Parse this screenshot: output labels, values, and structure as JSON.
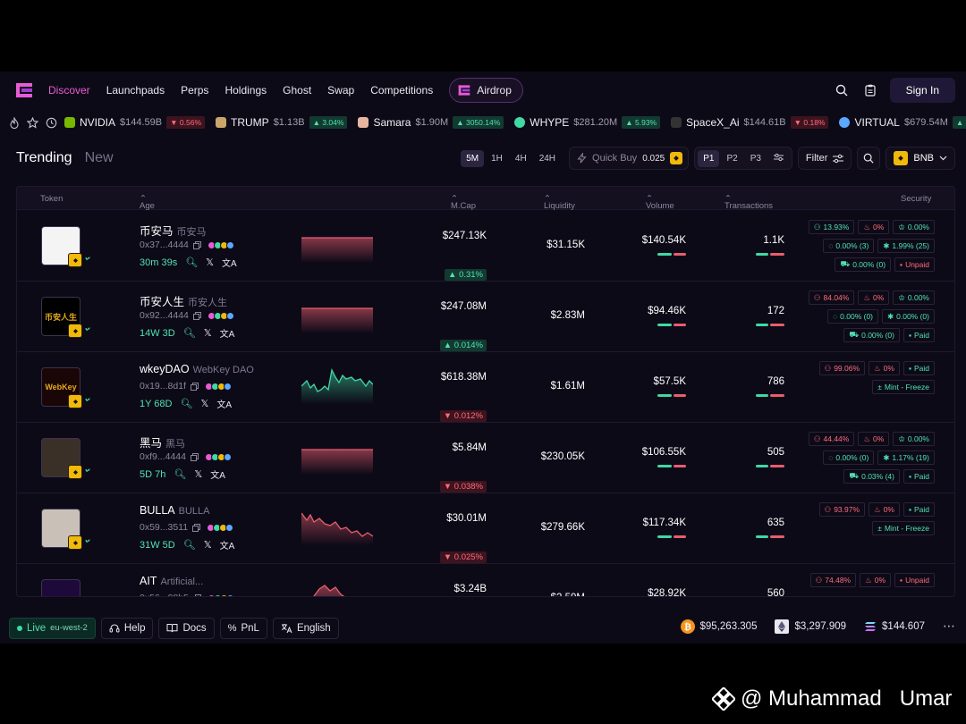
{
  "nav": {
    "items": [
      "Discover",
      "Launchpads",
      "Perps",
      "Holdings",
      "Ghost",
      "Swap",
      "Competitions"
    ],
    "airdrop_label": "Airdrop",
    "signin_label": "Sign In"
  },
  "ticker": [
    {
      "name": "NVIDIA",
      "value": "$144.59B",
      "change": "0.56%",
      "dir": "down",
      "color": "#76b900"
    },
    {
      "name": "TRUMP",
      "value": "$1.13B",
      "change": "3.04%",
      "dir": "up",
      "color": "#c9a56b"
    },
    {
      "name": "Samara",
      "value": "$1.90M",
      "change": "3050.14%",
      "dir": "up",
      "color": "#e8b6a0"
    },
    {
      "name": "WHYPE",
      "value": "$281.20M",
      "change": "5.93%",
      "dir": "up",
      "color": "#3fd9a4"
    },
    {
      "name": "SpaceX_Ai",
      "value": "$144.61B",
      "change": "0.18%",
      "dir": "down",
      "color": "#444444"
    },
    {
      "name": "VIRTUAL",
      "value": "$679.54M",
      "change": "3.",
      "dir": "up",
      "color": "#5aa8ff"
    }
  ],
  "trending": {
    "tabs": [
      "Trending",
      "New"
    ],
    "timeframes": [
      "5M",
      "1H",
      "4H",
      "24H"
    ],
    "quick_buy_label": "Quick Buy",
    "quick_buy_amount": "0.025",
    "presets": [
      "P1",
      "P2",
      "P3"
    ],
    "filter_label": "Filter",
    "chain_label": "BNB"
  },
  "table": {
    "headers": {
      "token": "Token",
      "age": "Age",
      "mcap": "M.Cap",
      "liquidity": "Liquidity",
      "volume": "Volume",
      "transactions": "Transactions",
      "security": "Security"
    },
    "rows": [
      {
        "name": "币安马",
        "sub": "币安马",
        "addr": "0x37...4444",
        "age": "30m 39s",
        "mcap": "$247.13K",
        "mchg": "0.31%",
        "mdir": "up",
        "liq": "$31.15K",
        "vol": "$140.54K",
        "txn": "1.1K",
        "spark": "flat",
        "avatar_color": "#f4f4f4",
        "sec": [
          [
            {
              "t": "13.93%",
              "c": "green",
              "i": "users"
            },
            {
              "t": "0%",
              "c": "red",
              "i": "fire"
            },
            {
              "t": "0.00%",
              "c": "green",
              "i": "chef"
            }
          ],
          [
            {
              "t": "0.00% (3)",
              "c": "green",
              "i": "ring"
            },
            {
              "t": "1.99% (25)",
              "c": "green",
              "i": "star"
            }
          ],
          [
            {
              "t": "0.00% (0)",
              "c": "green",
              "i": "car"
            },
            {
              "t": "Unpaid",
              "c": "red",
              "i": "lock"
            }
          ]
        ]
      },
      {
        "name": "币安人生",
        "sub": "币安人生",
        "addr": "0x92...4444",
        "age": "14W 3D",
        "mcap": "$247.08M",
        "mchg": "0.014%",
        "mdir": "up",
        "liq": "$2.83M",
        "vol": "$94.46K",
        "txn": "172",
        "spark": "flat",
        "avatar_color": "#000000",
        "avatar_text": "币安人生",
        "sec": [
          [
            {
              "t": "84.04%",
              "c": "red",
              "i": "users"
            },
            {
              "t": "0%",
              "c": "red",
              "i": "fire"
            },
            {
              "t": "0.00%",
              "c": "green",
              "i": "chef"
            }
          ],
          [
            {
              "t": "0.00% (0)",
              "c": "green",
              "i": "ring"
            },
            {
              "t": "0.00% (0)",
              "c": "green",
              "i": "star"
            }
          ],
          [
            {
              "t": "0.00% (0)",
              "c": "green",
              "i": "car"
            },
            {
              "t": "Paid",
              "c": "green",
              "i": "lock"
            }
          ]
        ]
      },
      {
        "name": "wkeyDAO",
        "sub": "WebKey DAO",
        "addr": "0x19...8d1f",
        "age": "1Y 68D",
        "mcap": "$618.38M",
        "mchg": "0.012%",
        "mdir": "down",
        "liq": "$1.61M",
        "vol": "$57.5K",
        "txn": "786",
        "spark": "green",
        "avatar_color": "#1a0606",
        "avatar_text": "WebKey",
        "sec": [
          [
            {
              "t": "99.06%",
              "c": "red",
              "i": "users"
            },
            {
              "t": "0%",
              "c": "red",
              "i": "fire"
            },
            {
              "t": "Paid",
              "c": "green",
              "i": "lock"
            }
          ],
          [
            {
              "t": "Mint - Freeze",
              "c": "green",
              "i": "plus"
            }
          ]
        ]
      },
      {
        "name": "黑马",
        "sub": "黑马",
        "addr": "0xf9...4444",
        "age": "5D 7h",
        "mcap": "$5.84M",
        "mchg": "0.038%",
        "mdir": "down",
        "liq": "$230.05K",
        "vol": "$106.55K",
        "txn": "505",
        "spark": "flat",
        "avatar_color": "#3a3028",
        "sec": [
          [
            {
              "t": "44.44%",
              "c": "red",
              "i": "users"
            },
            {
              "t": "0%",
              "c": "red",
              "i": "fire"
            },
            {
              "t": "0.00%",
              "c": "green",
              "i": "chef"
            }
          ],
          [
            {
              "t": "0.00% (0)",
              "c": "green",
              "i": "ring"
            },
            {
              "t": "1.17% (19)",
              "c": "green",
              "i": "star"
            }
          ],
          [
            {
              "t": "0.03% (4)",
              "c": "green",
              "i": "car"
            },
            {
              "t": "Paid",
              "c": "green",
              "i": "lock"
            }
          ]
        ]
      },
      {
        "name": "BULLA",
        "sub": "BULLA",
        "addr": "0x59...3511",
        "age": "31W 5D",
        "mcap": "$30.01M",
        "mchg": "0.025%",
        "mdir": "down",
        "liq": "$279.66K",
        "vol": "$117.34K",
        "txn": "635",
        "spark": "red",
        "avatar_color": "#c9c0b8",
        "sec": [
          [
            {
              "t": "93.97%",
              "c": "red",
              "i": "users"
            },
            {
              "t": "0%",
              "c": "red",
              "i": "fire"
            },
            {
              "t": "Paid",
              "c": "green",
              "i": "lock"
            }
          ],
          [
            {
              "t": "Mint - Freeze",
              "c": "green",
              "i": "plus"
            }
          ]
        ]
      },
      {
        "name": "AIT",
        "sub": "Artificial...",
        "addr": "0x56...08b5",
        "age": "",
        "mcap": "$3.24B",
        "mchg": "",
        "mdir": "down",
        "liq": "$2.59M",
        "vol": "$28.92K",
        "txn": "560",
        "spark": "red2",
        "avatar_color": "#1e0a3a",
        "sec": [
          [
            {
              "t": "74.48%",
              "c": "red",
              "i": "users"
            },
            {
              "t": "0%",
              "c": "red",
              "i": "fire"
            },
            {
              "t": "Unpaid",
              "c": "red",
              "i": "lock"
            }
          ]
        ]
      }
    ]
  },
  "footer": {
    "live_label": "Live",
    "region": "eu-west-2",
    "help_label": "Help",
    "docs_label": "Docs",
    "pnl_label": "PnL",
    "lang_label": "English",
    "btc_price": "$95,263.305",
    "eth_price": "$3,297.909",
    "sol_price": "$144.607"
  },
  "watermark": {
    "text": "@ Muhammad   Umar"
  }
}
